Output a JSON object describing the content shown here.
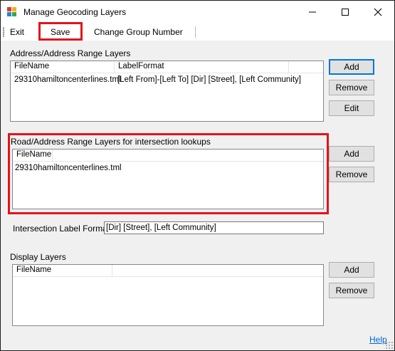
{
  "window": {
    "title": "Manage Geocoding Layers",
    "icon": "layers-app-icon"
  },
  "menu": {
    "exit": "Exit",
    "save": "Save",
    "change_group": "Change Group Number"
  },
  "address_layers": {
    "label": "Address/Address Range Layers",
    "columns": [
      "FileName",
      "LabelFormat",
      ""
    ],
    "rows": [
      {
        "filename": "29310hamiltoncenterlines.tml",
        "label_format": "[Left From]-[Left To] [Dir] [Street], [Left Community]"
      }
    ],
    "buttons": {
      "add": "Add",
      "remove": "Remove",
      "edit": "Edit"
    }
  },
  "road_layers": {
    "label": "Road/Address Range Layers for intersection lookups",
    "columns": [
      "FileName",
      ""
    ],
    "rows": [
      {
        "filename": "29310hamiltoncenterlines.tml"
      }
    ],
    "buttons": {
      "add": "Add",
      "remove": "Remove"
    }
  },
  "intersection": {
    "label": "Intersection Label Format",
    "value": "[Dir] [Street], [Left Community]"
  },
  "display_layers": {
    "label": "Display Layers",
    "columns": [
      "FileName",
      ""
    ],
    "rows": [],
    "buttons": {
      "add": "Add",
      "remove": "Remove"
    }
  },
  "footer": {
    "help": "Help"
  },
  "colors": {
    "highlight": "#e0151b",
    "accent": "#0078d7",
    "link": "#0066cc"
  }
}
